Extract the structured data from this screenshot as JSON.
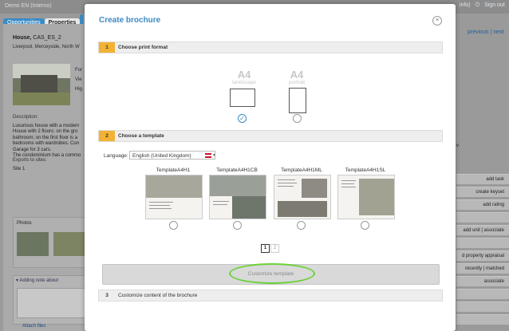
{
  "background": {
    "top_left": "Demo EN (Interno)",
    "top_right": [
      "info)",
      "Sign out"
    ],
    "tabs": [
      "Opportunities",
      "Properties"
    ],
    "property_title": "House,",
    "property_code": "CAS_ES_2",
    "property_location": "Liverpool, Merceyside, North W",
    "for_lines": [
      "For",
      "Vie",
      "Hig"
    ],
    "description_heading": "Description:",
    "description_lines": [
      "Luxurious house with a modern",
      "House with 2 floors: on the gro",
      "bathroom; on the first floor is a",
      "bedrooms with wardrobes. Con",
      "Garage for 3 cars.",
      "The condominium has a commo"
    ],
    "exports_heading": "Exports to sites:",
    "site": "Site 1",
    "photos_heading": "Photos",
    "note_heading": "▾ Adding note about",
    "attach": "Attach files",
    "nav": {
      "previous": "previous",
      "next": "next"
    },
    "right_buttons": [
      "add task",
      "create keyset",
      "add rating",
      "",
      "add unit | associate",
      "",
      "",
      "d property appraisal",
      "recently | matched",
      "associate",
      "",
      "",
      "",
      ""
    ],
    "right_v": "v"
  },
  "modal": {
    "title": "Create brochure",
    "close": "×",
    "step1": {
      "num": "1",
      "label": "Choose print format"
    },
    "formats": [
      {
        "size": "A4",
        "orientation": "landscape",
        "selected": true
      },
      {
        "size": "A4",
        "orientation": "portrait",
        "selected": false
      }
    ],
    "step2": {
      "num": "2",
      "label": "Choose a template"
    },
    "language_label": "Language:",
    "language_value": "English (United Kingdom)",
    "templates": [
      "TemplateA4H1",
      "TemplateA4H1CB",
      "TemplateA4H1ML",
      "TemplateA4H1SL"
    ],
    "pages": [
      "1",
      "2"
    ],
    "customize_label": "Customize template",
    "step3": {
      "num": "3",
      "label": "Customize content of the brochure"
    }
  },
  "colors": {
    "accent": "#3b8ac3",
    "step_active": "#f2b233",
    "highlight": "#6cd23a"
  }
}
